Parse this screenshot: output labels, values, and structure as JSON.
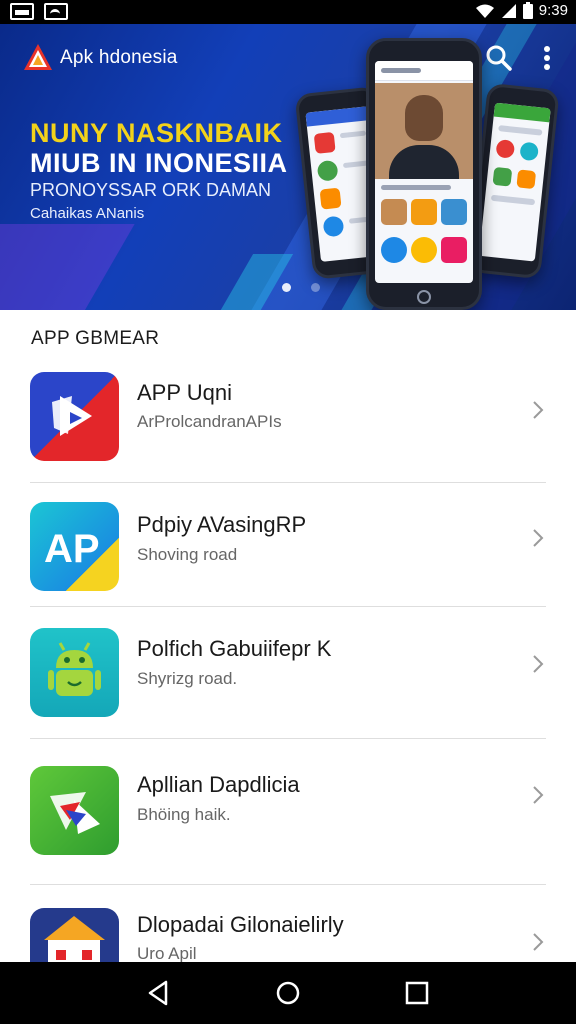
{
  "status_bar": {
    "time": "9:39"
  },
  "banner": {
    "brand": "Apk hdonesia",
    "headline_1": "NUNY NASKNBAIK",
    "headline_2": "MIUB IN INONESIIA",
    "sub_1": "PRONOYSSAR ORK DAMAN",
    "sub_2": "Cahaikas ANanis",
    "page_count": 2,
    "active_page": 1
  },
  "section": {
    "title": "APP GBMEAR"
  },
  "apps": [
    {
      "title": "APP Uqni",
      "subtitle": "ArProlcandranAPIs"
    },
    {
      "title": "Pdpiy AVasingRP",
      "subtitle": "Shoving road"
    },
    {
      "title": "Polfich Gabuiifepr K",
      "subtitle": "Shyrizg road."
    },
    {
      "title": "Apllian Dapdlicia",
      "subtitle": "Bhöing haik."
    },
    {
      "title": "Dlopadai Gilonaielirly",
      "subtitle": "Uro Apil"
    }
  ],
  "colors": {
    "banner_blue": "#123fb8",
    "headline_yellow": "#f2d21b",
    "accent_teal": "#1bb3c9",
    "accent_green": "#3aa63b"
  }
}
